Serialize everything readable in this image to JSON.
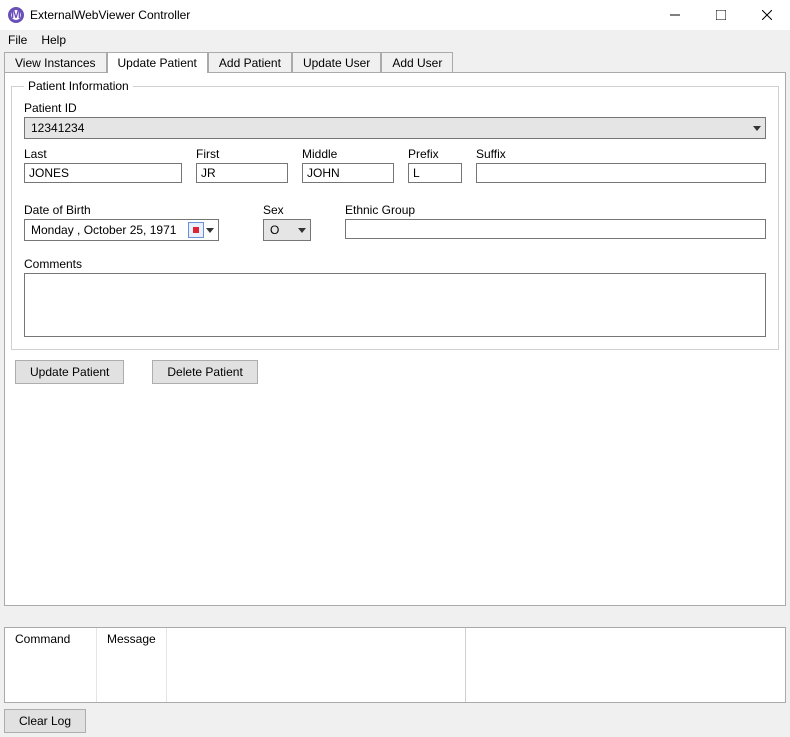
{
  "window": {
    "title": "ExternalWebViewer Controller"
  },
  "menu": {
    "file": "File",
    "help": "Help"
  },
  "tabs": {
    "view_instances": "View Instances",
    "update_patient": "Update Patient",
    "add_patient": "Add Patient",
    "update_user": "Update User",
    "add_user": "Add User"
  },
  "group": {
    "legend": "Patient Information"
  },
  "labels": {
    "patient_id": "Patient ID",
    "last": "Last",
    "first": "First",
    "middle": "Middle",
    "prefix": "Prefix",
    "suffix": "Suffix",
    "dob": "Date of Birth",
    "sex": "Sex",
    "ethnic": "Ethnic Group",
    "comments": "Comments"
  },
  "values": {
    "patient_id": "12341234",
    "last": "JONES",
    "first": "JR",
    "middle": "JOHN",
    "prefix": "L",
    "suffix": "",
    "dob": "Monday   ,   October   25, 1971",
    "sex": "O",
    "ethnic": "",
    "comments": ""
  },
  "buttons": {
    "update_patient": "Update Patient",
    "delete_patient": "Delete Patient",
    "clear_log": "Clear Log"
  },
  "log": {
    "col_command": "Command",
    "col_message": "Message"
  }
}
